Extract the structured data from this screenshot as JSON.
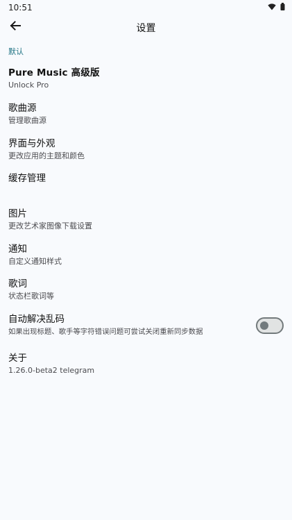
{
  "status_bar": {
    "time": "10:51",
    "icons": [
      "wifi-icon",
      "battery-icon"
    ]
  },
  "app_bar": {
    "back_icon": "arrow-left-icon",
    "title": "设置"
  },
  "section": {
    "label": "默认"
  },
  "settings": {
    "items": [
      {
        "title": "Pure Music 高级版",
        "subtitle": "Unlock Pro"
      },
      {
        "title": "歌曲源",
        "subtitle": "管理歌曲源"
      },
      {
        "title": "界面与外观",
        "subtitle": "更改应用的主题和颜色"
      },
      {
        "title": "缓存管理",
        "subtitle": ""
      },
      {
        "title": "图片",
        "subtitle": "更改艺术家图像下载设置"
      },
      {
        "title": "通知",
        "subtitle": "自定义通知样式"
      },
      {
        "title": "歌词",
        "subtitle": "状态栏歌词等"
      },
      {
        "title": "自动解决乱码",
        "subtitle": "如果出现标题、歌手等字符错误问题可尝试关闭重新同步数据",
        "toggle_on": false
      },
      {
        "title": "关于",
        "subtitle": "1.26.0-beta2 telegram"
      }
    ]
  },
  "colors": {
    "background": "#f8fafd",
    "accent": "#207384",
    "toggle_track": "#e1e3e3",
    "toggle_border": "#72797b"
  }
}
